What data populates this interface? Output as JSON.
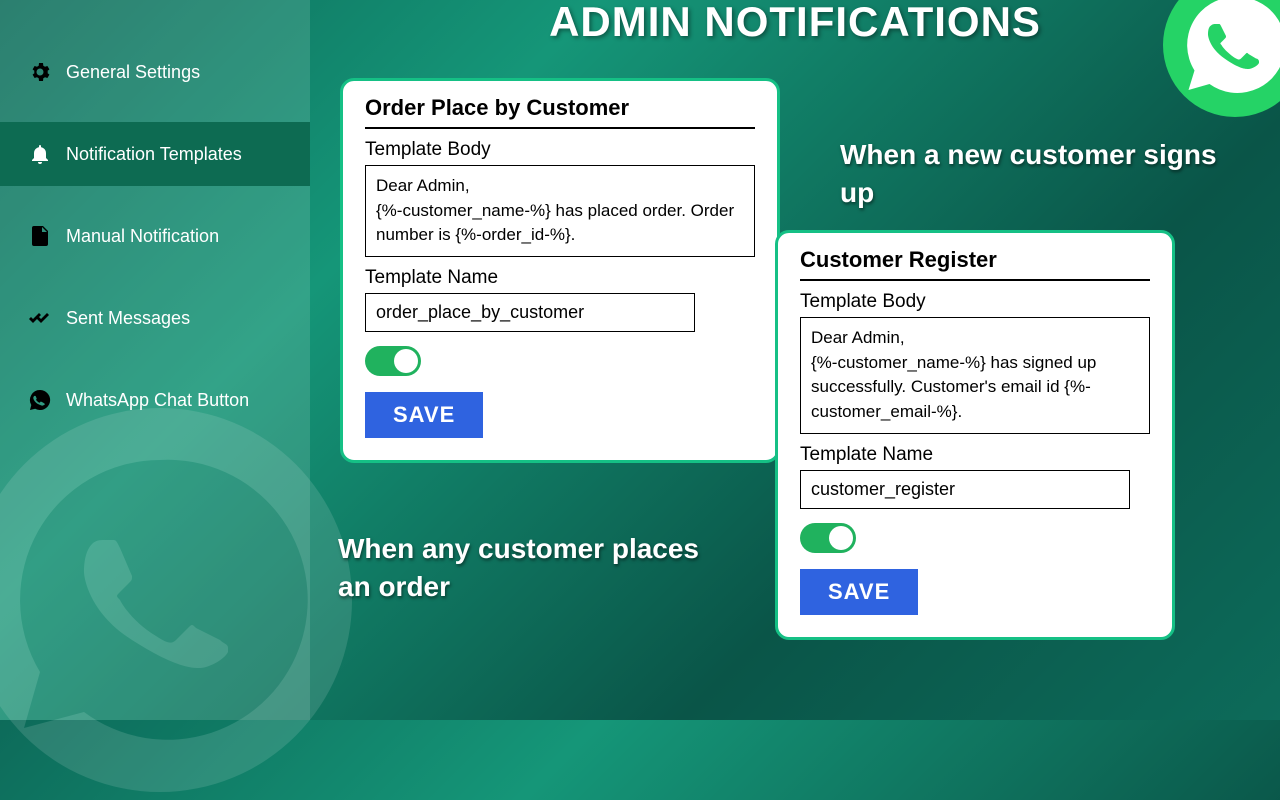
{
  "page": {
    "title": "ADMIN NOTIFICATIONS"
  },
  "sidebar": {
    "items": [
      {
        "label": "General Settings"
      },
      {
        "label": "Notification Templates"
      },
      {
        "label": "Manual Notification"
      },
      {
        "label": "Sent Messages"
      },
      {
        "label": "WhatsApp Chat Button"
      }
    ]
  },
  "callouts": {
    "order_placed": "When any customer places an order",
    "signup": "When a new customer signs up"
  },
  "cards": {
    "order": {
      "title": "Order Place by Customer",
      "body_label": "Template Body",
      "body": "Dear Admin,\n{%-customer_name-%} has placed order. Order number is {%-order_id-%}.",
      "name_label": "Template Name",
      "name": "order_place_by_customer",
      "toggle_on": true,
      "save_label": "SAVE"
    },
    "register": {
      "title": "Customer Register",
      "body_label": "Template Body",
      "body": "Dear Admin,\n{%-customer_name-%} has signed up successfully. Customer's email id {%-customer_email-%}.",
      "name_label": "Template Name",
      "name": "customer_register",
      "toggle_on": true,
      "save_label": "SAVE"
    }
  }
}
